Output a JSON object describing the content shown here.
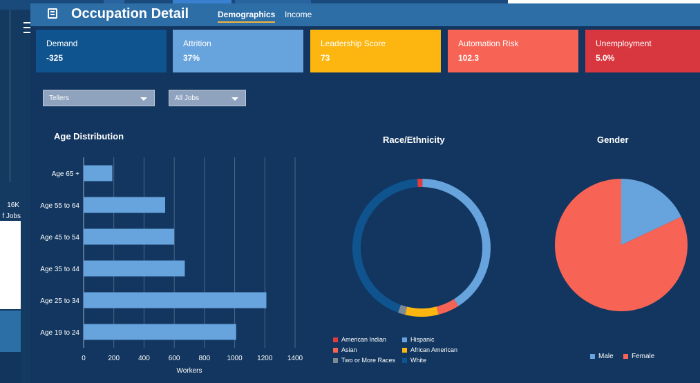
{
  "background": {
    "axis_value": "16K",
    "axis_label": "f Jobs"
  },
  "app": {
    "title": "Occupation Detail",
    "tabs": [
      "Demographics",
      "Income"
    ]
  },
  "kpis": [
    {
      "label": "Demand",
      "value": "-325",
      "color": "#0f548f"
    },
    {
      "label": "Attrition",
      "value": "37%",
      "color": "#67a3dc"
    },
    {
      "label": "Leadership Score",
      "value": "73",
      "color": "#fcb60f"
    },
    {
      "label": "Automation Risk",
      "value": "102.3",
      "color": "#f76355"
    },
    {
      "label": "Unemployment",
      "value": "5.0%",
      "color": "#d9373f"
    }
  ],
  "filters": {
    "occupation": "Tellers",
    "jobs": "All Jobs"
  },
  "age_chart": {
    "title": "Age Distribution"
  },
  "race_chart": {
    "title": "Race/Ethnicity"
  },
  "gender_chart": {
    "title": "Gender"
  },
  "chart_data": [
    {
      "type": "bar",
      "orientation": "horizontal",
      "title": "Age Distribution",
      "xlabel": "Workers",
      "ylabel": "",
      "categories": [
        "Age 65 +",
        "Age 55 to 64",
        "Age 45 to 54",
        "Age 35 to 44",
        "Age 25 to 34",
        "Age 19 to 24"
      ],
      "values": [
        190,
        540,
        600,
        670,
        1210,
        1010
      ],
      "xlim": [
        0,
        1400
      ],
      "xticks": [
        0,
        200,
        400,
        600,
        800,
        1000,
        1200,
        1400
      ],
      "grid": true,
      "color": "#67a3dc"
    },
    {
      "type": "pie",
      "variant": "donut",
      "title": "Race/Ethnicity",
      "series": [
        {
          "name": "American Indian",
          "value": 1.2,
          "color": "#e23b3f"
        },
        {
          "name": "Hispanic",
          "value": 40.8,
          "color": "#67a3dc"
        },
        {
          "name": "Asian",
          "value": 5.0,
          "color": "#f76355"
        },
        {
          "name": "African American",
          "value": 7.8,
          "color": "#fcb60f"
        },
        {
          "name": "Two or More Races",
          "value": 1.7,
          "color": "#7d8a96"
        },
        {
          "name": "White",
          "value": 43.5,
          "color": "#0f548f"
        }
      ],
      "legend": "bottom"
    },
    {
      "type": "pie",
      "title": "Gender",
      "series": [
        {
          "name": "Male",
          "value": 18,
          "color": "#67a3dc"
        },
        {
          "name": "Female",
          "value": 82,
          "color": "#f76355"
        }
      ],
      "legend": "bottom"
    }
  ]
}
